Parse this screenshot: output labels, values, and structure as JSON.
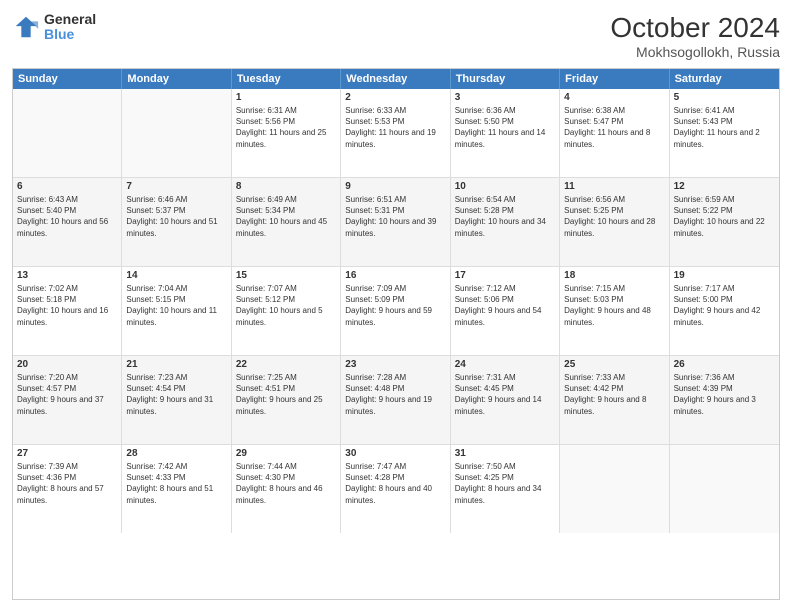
{
  "logo": {
    "general": "General",
    "blue": "Blue"
  },
  "title": "October 2024",
  "location": "Mokhsogollokh, Russia",
  "header_days": [
    "Sunday",
    "Monday",
    "Tuesday",
    "Wednesday",
    "Thursday",
    "Friday",
    "Saturday"
  ],
  "weeks": [
    [
      {
        "day": "",
        "sunrise": "",
        "sunset": "",
        "daylight": ""
      },
      {
        "day": "",
        "sunrise": "",
        "sunset": "",
        "daylight": ""
      },
      {
        "day": "1",
        "sunrise": "Sunrise: 6:31 AM",
        "sunset": "Sunset: 5:56 PM",
        "daylight": "Daylight: 11 hours and 25 minutes."
      },
      {
        "day": "2",
        "sunrise": "Sunrise: 6:33 AM",
        "sunset": "Sunset: 5:53 PM",
        "daylight": "Daylight: 11 hours and 19 minutes."
      },
      {
        "day": "3",
        "sunrise": "Sunrise: 6:36 AM",
        "sunset": "Sunset: 5:50 PM",
        "daylight": "Daylight: 11 hours and 14 minutes."
      },
      {
        "day": "4",
        "sunrise": "Sunrise: 6:38 AM",
        "sunset": "Sunset: 5:47 PM",
        "daylight": "Daylight: 11 hours and 8 minutes."
      },
      {
        "day": "5",
        "sunrise": "Sunrise: 6:41 AM",
        "sunset": "Sunset: 5:43 PM",
        "daylight": "Daylight: 11 hours and 2 minutes."
      }
    ],
    [
      {
        "day": "6",
        "sunrise": "Sunrise: 6:43 AM",
        "sunset": "Sunset: 5:40 PM",
        "daylight": "Daylight: 10 hours and 56 minutes."
      },
      {
        "day": "7",
        "sunrise": "Sunrise: 6:46 AM",
        "sunset": "Sunset: 5:37 PM",
        "daylight": "Daylight: 10 hours and 51 minutes."
      },
      {
        "day": "8",
        "sunrise": "Sunrise: 6:49 AM",
        "sunset": "Sunset: 5:34 PM",
        "daylight": "Daylight: 10 hours and 45 minutes."
      },
      {
        "day": "9",
        "sunrise": "Sunrise: 6:51 AM",
        "sunset": "Sunset: 5:31 PM",
        "daylight": "Daylight: 10 hours and 39 minutes."
      },
      {
        "day": "10",
        "sunrise": "Sunrise: 6:54 AM",
        "sunset": "Sunset: 5:28 PM",
        "daylight": "Daylight: 10 hours and 34 minutes."
      },
      {
        "day": "11",
        "sunrise": "Sunrise: 6:56 AM",
        "sunset": "Sunset: 5:25 PM",
        "daylight": "Daylight: 10 hours and 28 minutes."
      },
      {
        "day": "12",
        "sunrise": "Sunrise: 6:59 AM",
        "sunset": "Sunset: 5:22 PM",
        "daylight": "Daylight: 10 hours and 22 minutes."
      }
    ],
    [
      {
        "day": "13",
        "sunrise": "Sunrise: 7:02 AM",
        "sunset": "Sunset: 5:18 PM",
        "daylight": "Daylight: 10 hours and 16 minutes."
      },
      {
        "day": "14",
        "sunrise": "Sunrise: 7:04 AM",
        "sunset": "Sunset: 5:15 PM",
        "daylight": "Daylight: 10 hours and 11 minutes."
      },
      {
        "day": "15",
        "sunrise": "Sunrise: 7:07 AM",
        "sunset": "Sunset: 5:12 PM",
        "daylight": "Daylight: 10 hours and 5 minutes."
      },
      {
        "day": "16",
        "sunrise": "Sunrise: 7:09 AM",
        "sunset": "Sunset: 5:09 PM",
        "daylight": "Daylight: 9 hours and 59 minutes."
      },
      {
        "day": "17",
        "sunrise": "Sunrise: 7:12 AM",
        "sunset": "Sunset: 5:06 PM",
        "daylight": "Daylight: 9 hours and 54 minutes."
      },
      {
        "day": "18",
        "sunrise": "Sunrise: 7:15 AM",
        "sunset": "Sunset: 5:03 PM",
        "daylight": "Daylight: 9 hours and 48 minutes."
      },
      {
        "day": "19",
        "sunrise": "Sunrise: 7:17 AM",
        "sunset": "Sunset: 5:00 PM",
        "daylight": "Daylight: 9 hours and 42 minutes."
      }
    ],
    [
      {
        "day": "20",
        "sunrise": "Sunrise: 7:20 AM",
        "sunset": "Sunset: 4:57 PM",
        "daylight": "Daylight: 9 hours and 37 minutes."
      },
      {
        "day": "21",
        "sunrise": "Sunrise: 7:23 AM",
        "sunset": "Sunset: 4:54 PM",
        "daylight": "Daylight: 9 hours and 31 minutes."
      },
      {
        "day": "22",
        "sunrise": "Sunrise: 7:25 AM",
        "sunset": "Sunset: 4:51 PM",
        "daylight": "Daylight: 9 hours and 25 minutes."
      },
      {
        "day": "23",
        "sunrise": "Sunrise: 7:28 AM",
        "sunset": "Sunset: 4:48 PM",
        "daylight": "Daylight: 9 hours and 19 minutes."
      },
      {
        "day": "24",
        "sunrise": "Sunrise: 7:31 AM",
        "sunset": "Sunset: 4:45 PM",
        "daylight": "Daylight: 9 hours and 14 minutes."
      },
      {
        "day": "25",
        "sunrise": "Sunrise: 7:33 AM",
        "sunset": "Sunset: 4:42 PM",
        "daylight": "Daylight: 9 hours and 8 minutes."
      },
      {
        "day": "26",
        "sunrise": "Sunrise: 7:36 AM",
        "sunset": "Sunset: 4:39 PM",
        "daylight": "Daylight: 9 hours and 3 minutes."
      }
    ],
    [
      {
        "day": "27",
        "sunrise": "Sunrise: 7:39 AM",
        "sunset": "Sunset: 4:36 PM",
        "daylight": "Daylight: 8 hours and 57 minutes."
      },
      {
        "day": "28",
        "sunrise": "Sunrise: 7:42 AM",
        "sunset": "Sunset: 4:33 PM",
        "daylight": "Daylight: 8 hours and 51 minutes."
      },
      {
        "day": "29",
        "sunrise": "Sunrise: 7:44 AM",
        "sunset": "Sunset: 4:30 PM",
        "daylight": "Daylight: 8 hours and 46 minutes."
      },
      {
        "day": "30",
        "sunrise": "Sunrise: 7:47 AM",
        "sunset": "Sunset: 4:28 PM",
        "daylight": "Daylight: 8 hours and 40 minutes."
      },
      {
        "day": "31",
        "sunrise": "Sunrise: 7:50 AM",
        "sunset": "Sunset: 4:25 PM",
        "daylight": "Daylight: 8 hours and 34 minutes."
      },
      {
        "day": "",
        "sunrise": "",
        "sunset": "",
        "daylight": ""
      },
      {
        "day": "",
        "sunrise": "",
        "sunset": "",
        "daylight": ""
      }
    ]
  ]
}
